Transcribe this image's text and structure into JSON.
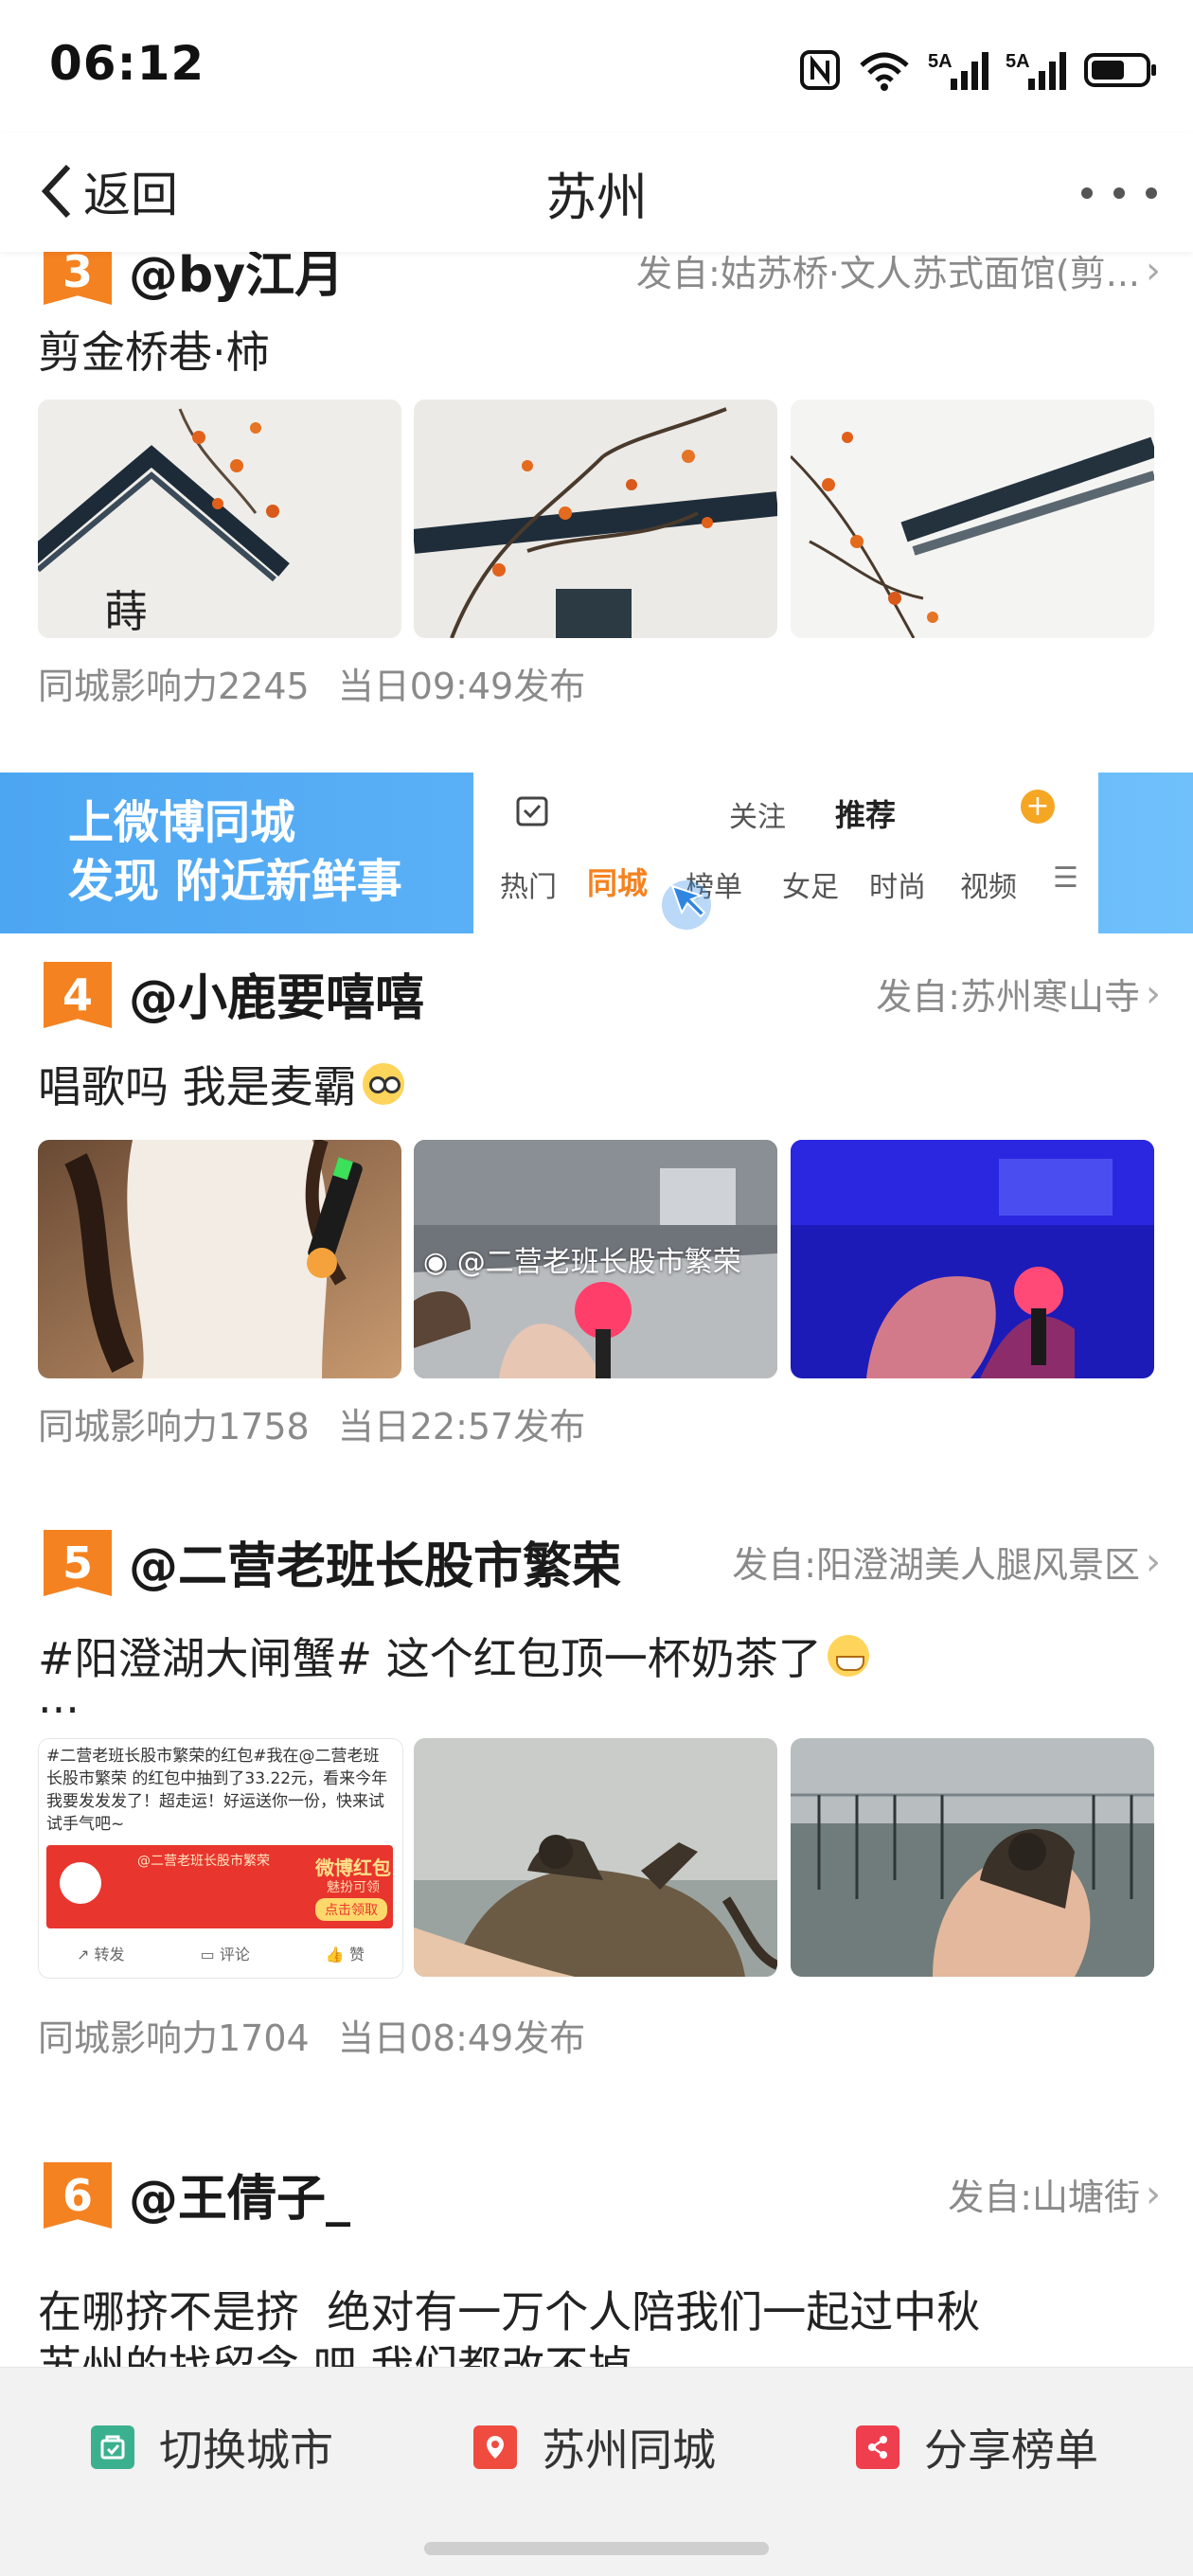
{
  "status_bar": {
    "time": "06:12"
  },
  "nav": {
    "back_label": "返回",
    "title": "苏州"
  },
  "posts": [
    {
      "rank": "3",
      "username": "@by江月",
      "source": "发自:姑苏桥·文人苏式面馆(剪...",
      "text": "剪金桥巷·柿",
      "influence": "同城影响力2245",
      "time": "当日09:49发布"
    },
    {
      "rank": "4",
      "username": "@小鹿要嘻嘻",
      "source": "发自:苏州寒山寺",
      "text": "唱歌吗 我是麦霸",
      "watermark": "@二营老班长股市繁荣",
      "influence": "同城影响力1758",
      "time": "当日22:57发布"
    },
    {
      "rank": "5",
      "username": "@二营老班长股市繁荣",
      "source": "发自:阳澄湖美人腿风景区",
      "text": "#阳澄湖大闸蟹# 这个红包顶一杯奶茶了",
      "text_more": "...",
      "influence": "同城影响力1704",
      "time": "当日08:49发布",
      "card": {
        "body": "#二营老班长股市繁荣的红包#我在@二营老班长股市繁荣 的红包中抽到了33.22元，看来今年我要发发发了！超走运！好运送你一份，快来试试手气吧~",
        "red_title": "微博红包",
        "red_sub": "魅扮可领",
        "red_btn": "点击领取",
        "red_user": "@二营老班长股市繁荣",
        "action_forward": "转发",
        "action_comment": "评论",
        "action_like": "赞"
      }
    },
    {
      "rank": "6",
      "username": "@王倩子_",
      "source": "发自:山塘街",
      "text": "在哪挤不是挤  绝对有一万个人陪我们一起过中秋",
      "text_line2": "苏州的找留念 吧  我们都改不掉"
    }
  ],
  "banner": {
    "line1": "上微博同城",
    "line2": "发现 附近新鲜事",
    "tabs_top": [
      "关注",
      "推荐"
    ],
    "tabs_bottom": [
      "热门",
      "同城",
      "榜单",
      "女足",
      "时尚",
      "视频"
    ]
  },
  "bottom_bar": {
    "switch_city": "切换城市",
    "local": "苏州同城",
    "share": "分享榜单"
  },
  "colors": {
    "accent": "#f58220",
    "banner_blue": "#4da6f2"
  }
}
